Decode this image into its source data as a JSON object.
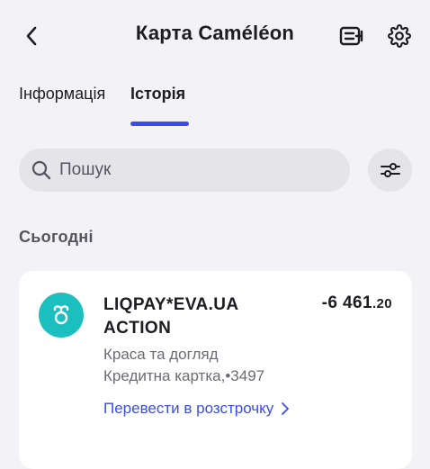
{
  "header": {
    "title": "Карта Caméléon",
    "back_icon": "chevron-left-icon",
    "card_icon": "card-details-icon",
    "settings_icon": "gear-icon"
  },
  "tabs": [
    {
      "label": "Інформація",
      "active": false
    },
    {
      "label": "Історія",
      "active": true
    }
  ],
  "search": {
    "placeholder": "Пошук",
    "value": ""
  },
  "section": {
    "label": "Сьогодні"
  },
  "transaction": {
    "merchant_line1": "LIQPAY*EVA.UA",
    "merchant_line2": "ACTION",
    "amount_main": "-6 461",
    "amount_cents": ".20",
    "category": "Краса та догляд",
    "card": "Кредитна картка,•3497",
    "action_label": "Перевести в розстрочку"
  },
  "colors": {
    "accent": "#3b4ce8",
    "merchant_logo_bg": "#1cbfc0",
    "background": "#f3f3f7"
  }
}
